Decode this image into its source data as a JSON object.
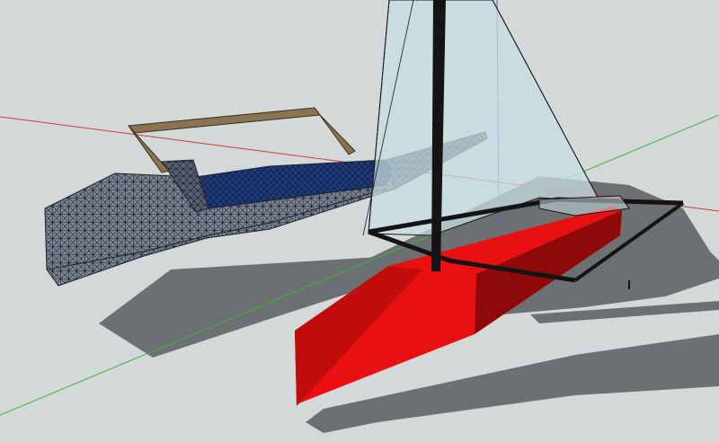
{
  "viewport": {
    "name": "3d-model-viewport",
    "colors": {
      "background": "#d3d8d8",
      "shadow": "#6d7073",
      "red_axis": "#d23a3a",
      "green_axis": "#3cb33c",
      "blue_axis": "#4a63d8",
      "hull_red": "#e81010",
      "hull_red_dark": "#8e0a0a",
      "hull_red_mid": "#c10c0c",
      "mesh_fill": "#7d8593",
      "mesh_line": "#1e2330",
      "deck_blue": "#1e3a78",
      "wood": "#8a7353",
      "sail": "#c7dde2",
      "frame": "#141414"
    }
  },
  "models": [
    {
      "id": "mesh-hull",
      "label": "wireframe-hull"
    },
    {
      "id": "red-hull",
      "label": "red-hull"
    },
    {
      "id": "mast",
      "label": "mast"
    },
    {
      "id": "sail",
      "label": "sail"
    }
  ]
}
